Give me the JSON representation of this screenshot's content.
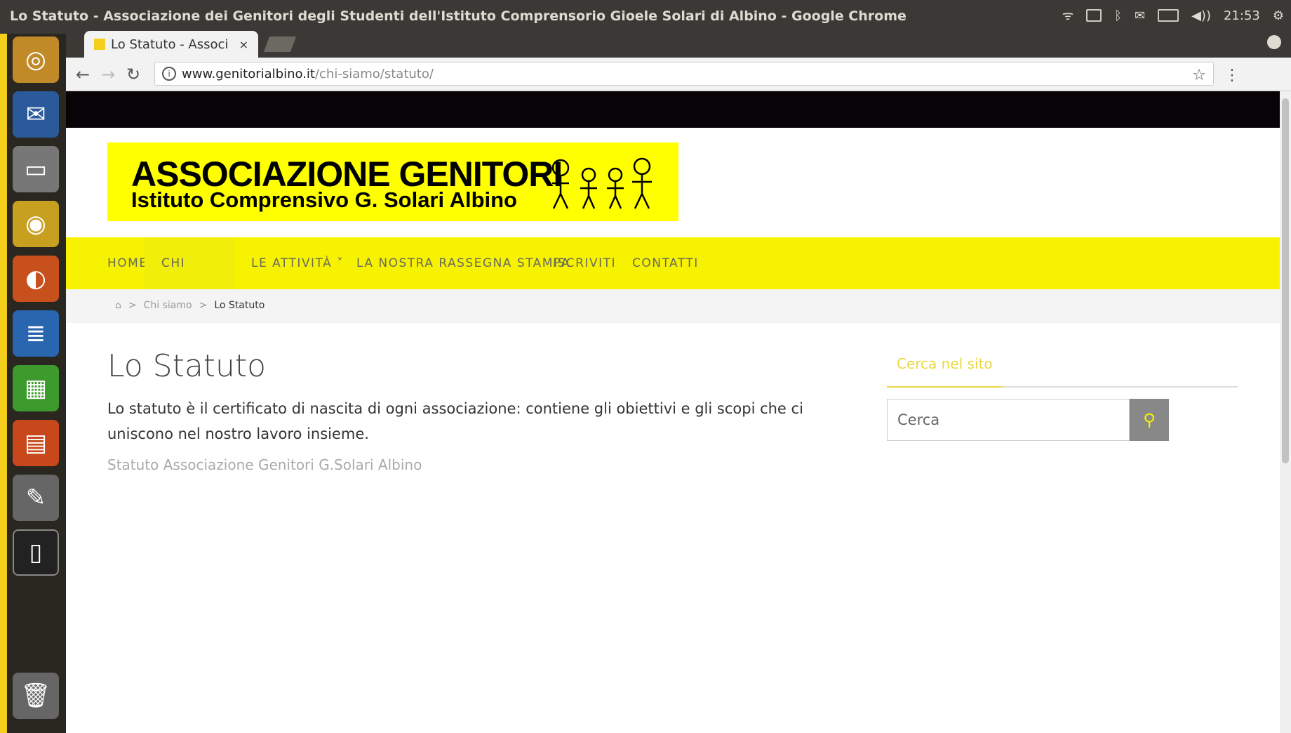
{
  "window": {
    "title": "Lo Statuto - Associazione dei Genitori degli Studenti dell'Istituto Comprensorio Gioele Solari di Albino - Google Chrome"
  },
  "tray": {
    "time": "21:53",
    "volume": "◀))"
  },
  "launcher": {
    "icons": [
      "ubuntu-dash-icon",
      "thunderbird-icon",
      "files-icon",
      "chrome-icon",
      "firefox-icon",
      "writer-icon",
      "calc-icon",
      "impress-icon",
      "settings-icon",
      "terminal-icon",
      "trash-icon"
    ]
  },
  "browser": {
    "tab_title": "Lo Statuto - Associ",
    "tab_close": "×",
    "url_host": "www.genitorialbino.it",
    "url_path": "/chi-siamo/statuto/"
  },
  "site": {
    "logo_line1": "ASSOCIAZIONE GENITORI",
    "logo_line2": "Istituto Comprensivo G. Solari Albino",
    "nav": [
      {
        "label": "HOME"
      },
      {
        "label": "CHI SIAMO ˅"
      },
      {
        "label": "LE ATTIVITÀ ˅"
      },
      {
        "label": "LA NOSTRA RASSEGNA STAMPA"
      },
      {
        "label": "ISCRIVITI"
      },
      {
        "label": "CONTATTI"
      }
    ],
    "breadcrumb": {
      "sep": ">",
      "parent": "Chi siamo",
      "current": "Lo Statuto"
    },
    "page_title": "Lo Statuto",
    "intro": "Lo statuto è il certificato di nascita di ogni associazione: contiene gli obiettivi e gli scopi che ci uniscono nel nostro lavoro insieme.",
    "doc_link": "Statuto Associazione Genitori G.Solari Albino",
    "sidebar": {
      "widget_title": "Cerca nel sito",
      "search_placeholder": "Cerca"
    }
  },
  "colors": {
    "accent_yellow": "#f7f300",
    "logo_yellow": "#ffff00",
    "ubuntu_panel": "#3a3935"
  }
}
